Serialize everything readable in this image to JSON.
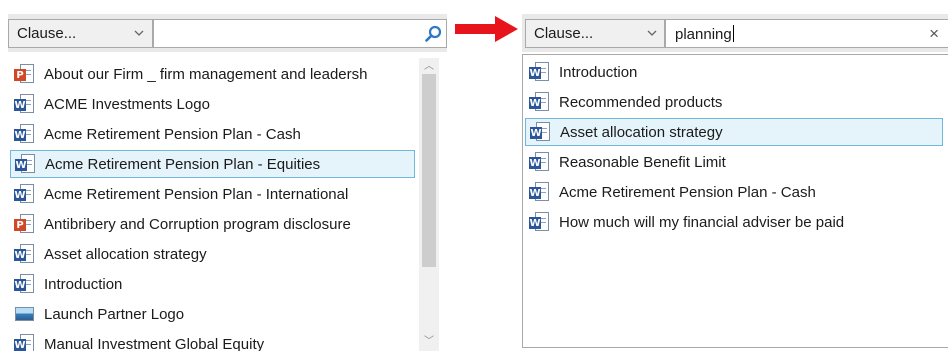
{
  "left": {
    "combo_label": "Clause...",
    "search_value": "",
    "items": [
      {
        "icon": "powerpoint-icon",
        "badge": "P",
        "label": "About our Firm _  firm management and leadersh"
      },
      {
        "icon": "word-icon",
        "badge": "W",
        "label": "ACME Investments Logo"
      },
      {
        "icon": "word-icon",
        "badge": "W",
        "label": "Acme Retirement Pension Plan - Cash"
      },
      {
        "icon": "word-icon",
        "badge": "W",
        "label": "Acme Retirement Pension Plan - Equities"
      },
      {
        "icon": "word-icon",
        "badge": "W",
        "label": "Acme Retirement Pension Plan - International"
      },
      {
        "icon": "powerpoint-icon",
        "badge": "P",
        "label": "Antibribery and Corruption program disclosure"
      },
      {
        "icon": "word-icon",
        "badge": "W",
        "label": "Asset allocation strategy"
      },
      {
        "icon": "word-icon",
        "badge": "W",
        "label": "Introduction"
      },
      {
        "icon": "image-icon",
        "badge": "",
        "label": "Launch Partner Logo"
      },
      {
        "icon": "word-icon",
        "badge": "W",
        "label": "Manual Investment Global Equity"
      }
    ],
    "selected_index": 3
  },
  "right": {
    "combo_label": "Clause...",
    "search_value": "planning",
    "clear_glyph": "×",
    "items": [
      {
        "icon": "word-icon",
        "badge": "W",
        "label": "Introduction"
      },
      {
        "icon": "word-icon",
        "badge": "W",
        "label": "Recommended products"
      },
      {
        "icon": "word-icon",
        "badge": "W",
        "label": "Asset allocation strategy"
      },
      {
        "icon": "word-icon",
        "badge": "W",
        "label": "Reasonable Benefit Limit"
      },
      {
        "icon": "word-icon",
        "badge": "W",
        "label": "Acme Retirement Pension Plan - Cash"
      },
      {
        "icon": "word-icon",
        "badge": "W",
        "label": "How much will my financial adviser be paid"
      }
    ],
    "selected_index": 2
  },
  "colors": {
    "arrow": "#e8141b",
    "selection_bg": "#e5f3fb",
    "selection_border": "#70b9dd",
    "word": "#2b579a",
    "powerpoint": "#d24726"
  }
}
